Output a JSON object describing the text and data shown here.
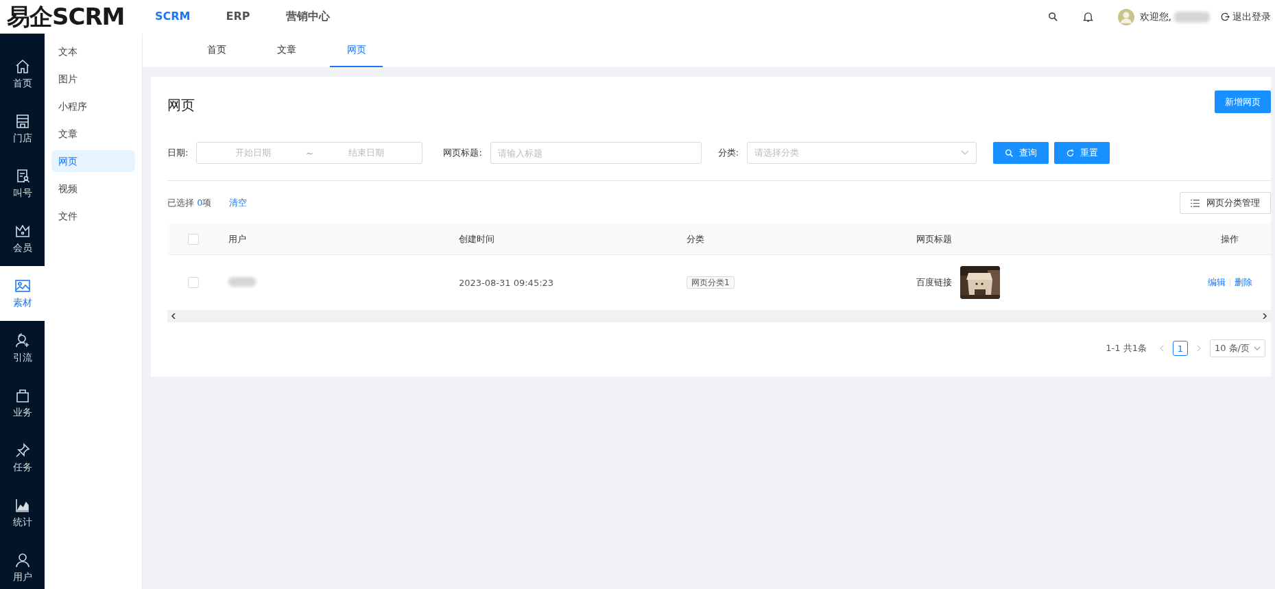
{
  "logo": "易企SCRM",
  "top_nav": [
    {
      "label": "SCRM",
      "selected": true
    },
    {
      "label": "ERP",
      "selected": false
    },
    {
      "label": "营销中心",
      "selected": false
    }
  ],
  "header": {
    "greeting": "欢迎您,",
    "logout": "退出登录"
  },
  "side_nav": [
    {
      "kind": "home",
      "label": "首页",
      "selected": false
    },
    {
      "kind": "store",
      "label": "门店",
      "selected": false
    },
    {
      "kind": "queue",
      "label": "叫号",
      "selected": false
    },
    {
      "kind": "member",
      "label": "会员",
      "selected": false
    },
    {
      "kind": "material",
      "label": "素材",
      "selected": true
    },
    {
      "kind": "traffic",
      "label": "引流",
      "selected": false
    },
    {
      "kind": "business",
      "label": "业务",
      "selected": false
    },
    {
      "kind": "task",
      "label": "任务",
      "selected": false
    },
    {
      "kind": "stats",
      "label": "统计",
      "selected": false
    },
    {
      "kind": "user",
      "label": "用户",
      "selected": false
    }
  ],
  "sub_nav": [
    {
      "label": "文本",
      "selected": false
    },
    {
      "label": "图片",
      "selected": false
    },
    {
      "label": "小程序",
      "selected": false
    },
    {
      "label": "文章",
      "selected": false
    },
    {
      "label": "网页",
      "selected": true
    },
    {
      "label": "视频",
      "selected": false
    },
    {
      "label": "文件",
      "selected": false
    }
  ],
  "tabs": [
    {
      "label": "首页",
      "selected": false
    },
    {
      "label": "文章",
      "selected": false
    },
    {
      "label": "网页",
      "selected": true
    }
  ],
  "page": {
    "title": "网页",
    "add_button": "新增网页"
  },
  "filters": {
    "date_label": "日期:",
    "start_placeholder": "开始日期",
    "separator": "~",
    "end_placeholder": "结束日期",
    "title_label": "网页标题:",
    "title_placeholder": "请输入标题",
    "category_label": "分类:",
    "category_placeholder": "请选择分类",
    "search_button": "查询",
    "reset_button": "重置"
  },
  "selection": {
    "prefix": "已选择",
    "count": "0",
    "suffix": "项",
    "clear": "清空"
  },
  "manage_button": "网页分类管理",
  "table": {
    "all_checked": false,
    "columns": [
      "用户",
      "创建时间",
      "分类",
      "网页标题",
      "操作"
    ],
    "rows": [
      {
        "checked": false,
        "created": "2023-08-31 09:45:23",
        "category": "网页分类1",
        "title": "百度链接",
        "thumbnail": {
          "kind": "picture"
        },
        "actions": [
          "编辑",
          "删除"
        ]
      }
    ]
  },
  "pagination": {
    "summary": "1-1 共1条",
    "pages": [
      {
        "label": "1",
        "selected": true
      }
    ],
    "page_size": "10 条/页"
  }
}
